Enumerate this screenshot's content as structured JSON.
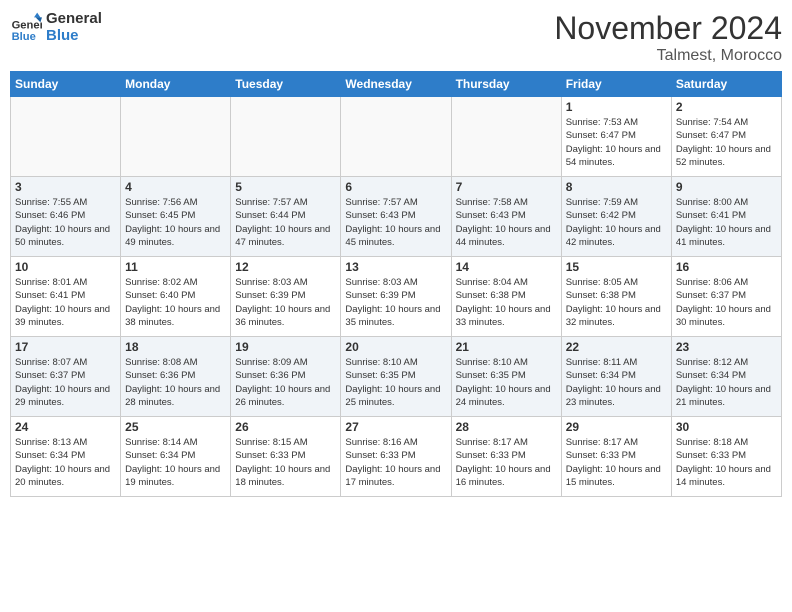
{
  "header": {
    "logo_general": "General",
    "logo_blue": "Blue",
    "month_title": "November 2024",
    "location": "Talmest, Morocco"
  },
  "days_of_week": [
    "Sunday",
    "Monday",
    "Tuesday",
    "Wednesday",
    "Thursday",
    "Friday",
    "Saturday"
  ],
  "weeks": [
    [
      {
        "day": "",
        "info": ""
      },
      {
        "day": "",
        "info": ""
      },
      {
        "day": "",
        "info": ""
      },
      {
        "day": "",
        "info": ""
      },
      {
        "day": "",
        "info": ""
      },
      {
        "day": "1",
        "info": "Sunrise: 7:53 AM\nSunset: 6:47 PM\nDaylight: 10 hours and 54 minutes."
      },
      {
        "day": "2",
        "info": "Sunrise: 7:54 AM\nSunset: 6:47 PM\nDaylight: 10 hours and 52 minutes."
      }
    ],
    [
      {
        "day": "3",
        "info": "Sunrise: 7:55 AM\nSunset: 6:46 PM\nDaylight: 10 hours and 50 minutes."
      },
      {
        "day": "4",
        "info": "Sunrise: 7:56 AM\nSunset: 6:45 PM\nDaylight: 10 hours and 49 minutes."
      },
      {
        "day": "5",
        "info": "Sunrise: 7:57 AM\nSunset: 6:44 PM\nDaylight: 10 hours and 47 minutes."
      },
      {
        "day": "6",
        "info": "Sunrise: 7:57 AM\nSunset: 6:43 PM\nDaylight: 10 hours and 45 minutes."
      },
      {
        "day": "7",
        "info": "Sunrise: 7:58 AM\nSunset: 6:43 PM\nDaylight: 10 hours and 44 minutes."
      },
      {
        "day": "8",
        "info": "Sunrise: 7:59 AM\nSunset: 6:42 PM\nDaylight: 10 hours and 42 minutes."
      },
      {
        "day": "9",
        "info": "Sunrise: 8:00 AM\nSunset: 6:41 PM\nDaylight: 10 hours and 41 minutes."
      }
    ],
    [
      {
        "day": "10",
        "info": "Sunrise: 8:01 AM\nSunset: 6:41 PM\nDaylight: 10 hours and 39 minutes."
      },
      {
        "day": "11",
        "info": "Sunrise: 8:02 AM\nSunset: 6:40 PM\nDaylight: 10 hours and 38 minutes."
      },
      {
        "day": "12",
        "info": "Sunrise: 8:03 AM\nSunset: 6:39 PM\nDaylight: 10 hours and 36 minutes."
      },
      {
        "day": "13",
        "info": "Sunrise: 8:03 AM\nSunset: 6:39 PM\nDaylight: 10 hours and 35 minutes."
      },
      {
        "day": "14",
        "info": "Sunrise: 8:04 AM\nSunset: 6:38 PM\nDaylight: 10 hours and 33 minutes."
      },
      {
        "day": "15",
        "info": "Sunrise: 8:05 AM\nSunset: 6:38 PM\nDaylight: 10 hours and 32 minutes."
      },
      {
        "day": "16",
        "info": "Sunrise: 8:06 AM\nSunset: 6:37 PM\nDaylight: 10 hours and 30 minutes."
      }
    ],
    [
      {
        "day": "17",
        "info": "Sunrise: 8:07 AM\nSunset: 6:37 PM\nDaylight: 10 hours and 29 minutes."
      },
      {
        "day": "18",
        "info": "Sunrise: 8:08 AM\nSunset: 6:36 PM\nDaylight: 10 hours and 28 minutes."
      },
      {
        "day": "19",
        "info": "Sunrise: 8:09 AM\nSunset: 6:36 PM\nDaylight: 10 hours and 26 minutes."
      },
      {
        "day": "20",
        "info": "Sunrise: 8:10 AM\nSunset: 6:35 PM\nDaylight: 10 hours and 25 minutes."
      },
      {
        "day": "21",
        "info": "Sunrise: 8:10 AM\nSunset: 6:35 PM\nDaylight: 10 hours and 24 minutes."
      },
      {
        "day": "22",
        "info": "Sunrise: 8:11 AM\nSunset: 6:34 PM\nDaylight: 10 hours and 23 minutes."
      },
      {
        "day": "23",
        "info": "Sunrise: 8:12 AM\nSunset: 6:34 PM\nDaylight: 10 hours and 21 minutes."
      }
    ],
    [
      {
        "day": "24",
        "info": "Sunrise: 8:13 AM\nSunset: 6:34 PM\nDaylight: 10 hours and 20 minutes."
      },
      {
        "day": "25",
        "info": "Sunrise: 8:14 AM\nSunset: 6:34 PM\nDaylight: 10 hours and 19 minutes."
      },
      {
        "day": "26",
        "info": "Sunrise: 8:15 AM\nSunset: 6:33 PM\nDaylight: 10 hours and 18 minutes."
      },
      {
        "day": "27",
        "info": "Sunrise: 8:16 AM\nSunset: 6:33 PM\nDaylight: 10 hours and 17 minutes."
      },
      {
        "day": "28",
        "info": "Sunrise: 8:17 AM\nSunset: 6:33 PM\nDaylight: 10 hours and 16 minutes."
      },
      {
        "day": "29",
        "info": "Sunrise: 8:17 AM\nSunset: 6:33 PM\nDaylight: 10 hours and 15 minutes."
      },
      {
        "day": "30",
        "info": "Sunrise: 8:18 AM\nSunset: 6:33 PM\nDaylight: 10 hours and 14 minutes."
      }
    ]
  ]
}
